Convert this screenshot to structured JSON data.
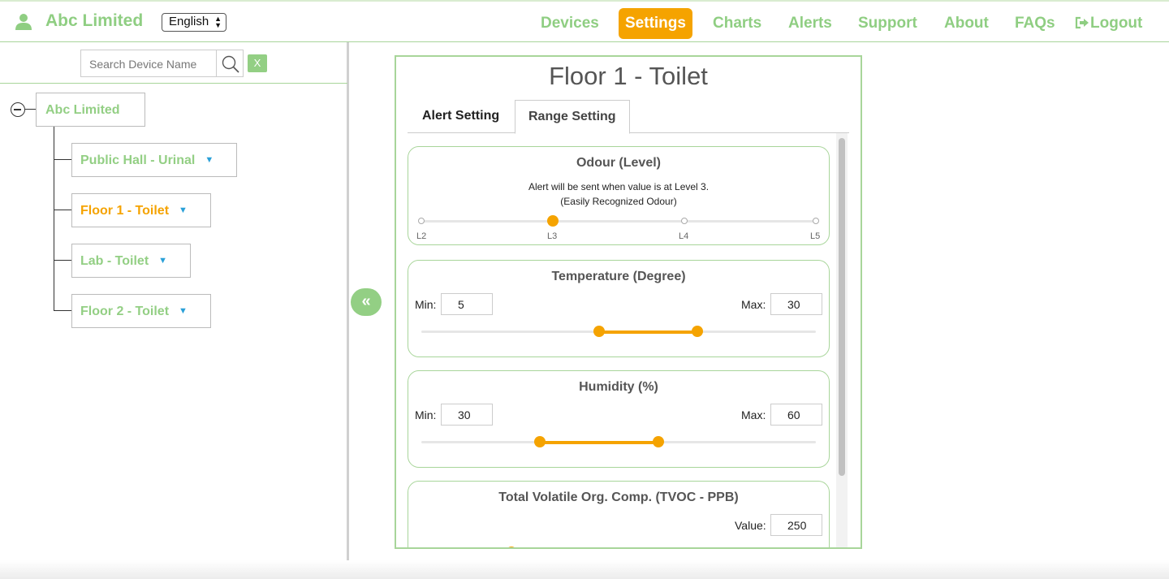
{
  "header": {
    "brand": "Abc Limited",
    "language": "English",
    "nav": [
      "Devices",
      "Settings",
      "Charts",
      "Alerts",
      "Support",
      "About",
      "FAQs",
      "Logout"
    ],
    "active_nav": "Settings"
  },
  "sidebar": {
    "search_placeholder": "Search Device Name",
    "clear_label": "X",
    "root": "Abc Limited",
    "devices": [
      "Public Hall - Urinal",
      "Floor 1 - Toilet",
      "Lab - Toilet",
      "Floor 2 - Toilet"
    ],
    "selected_device": "Floor 1 - Toilet",
    "collapse_label": "«"
  },
  "panel": {
    "title": "Floor 1 - Toilet",
    "tabs": [
      "Alert Setting",
      "Range Setting"
    ],
    "active_tab": "Range Setting",
    "odour": {
      "title": "Odour (Level)",
      "note_line1": "Alert will be sent when value is at Level 3.",
      "note_line2": "(Easily Recognized Odour)",
      "levels": [
        "L2",
        "L3",
        "L4",
        "L5"
      ],
      "selected_level": "L3"
    },
    "temperature": {
      "title": "Temperature (Degree)",
      "min_label": "Min:",
      "max_label": "Max:",
      "min": "5",
      "max": "30"
    },
    "humidity": {
      "title": "Humidity (%)",
      "min_label": "Min:",
      "max_label": "Max:",
      "min": "30",
      "max": "60"
    },
    "tvoc": {
      "title": "Total Volatile Org. Comp. (TVOC - PPB)",
      "value_label": "Value:",
      "value": "250"
    }
  },
  "colors": {
    "brand_green": "#8fce82",
    "accent_orange": "#f5a300",
    "border_green": "#a8d59a"
  }
}
